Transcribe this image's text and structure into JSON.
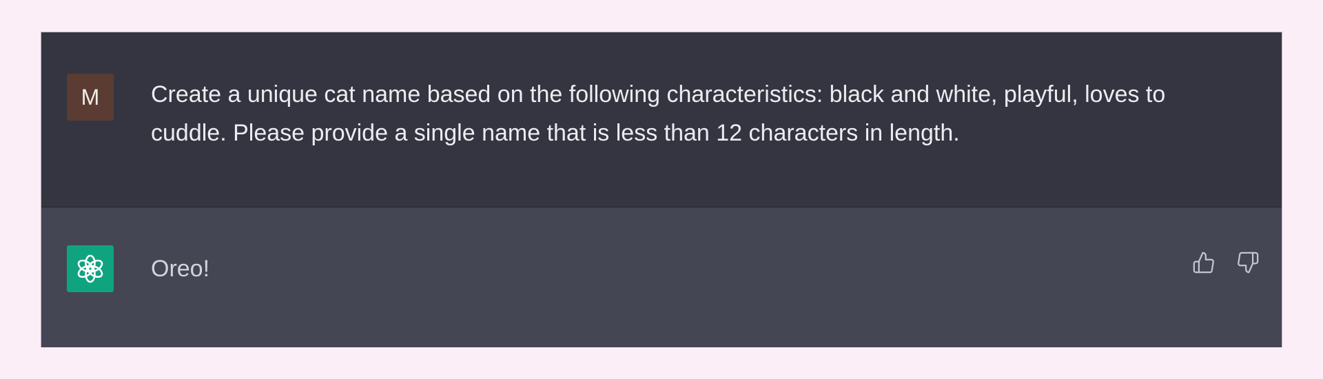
{
  "conversation": {
    "user_message": {
      "avatar_initial": "M",
      "text": "Create a unique cat name based on the following characteristics: black and white, playful, loves to cuddle. Please provide a single name that is less than 12 characters in length."
    },
    "assistant_message": {
      "avatar_icon": "openai-logo-icon",
      "text": "Oreo!",
      "feedback_icons": [
        "thumbs-up-icon",
        "thumbs-down-icon"
      ]
    }
  },
  "colors": {
    "page_background": "#fbeef7",
    "user_row": "#343541",
    "assistant_row": "#444654",
    "user_avatar": "#5a3c33",
    "assistant_avatar": "#10a37f",
    "text": "#ececf1"
  }
}
